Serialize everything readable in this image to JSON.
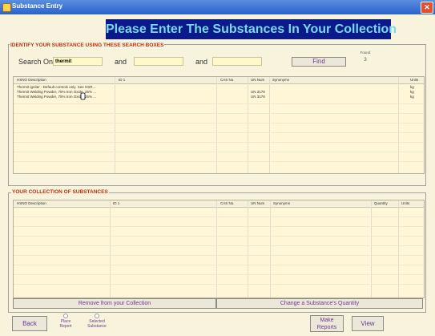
{
  "window": {
    "title": "Substance Entry",
    "close": "✕"
  },
  "banner": "Please Enter The Substances In Your Collection",
  "search": {
    "section_title": "IDENTIFY YOUR SUBSTANCE USING THESE SEARCH BOXES",
    "label": "Search On",
    "value1": "thermit",
    "and1": "and",
    "value2": "",
    "and2": "and",
    "value3": "",
    "find_button": "Find",
    "found_label": "Found",
    "found_count": "3"
  },
  "results": {
    "headers": [
      "HSNO Description",
      "ID 1",
      "CAS No.",
      "UN Num",
      "Synonyms",
      "Units"
    ],
    "rows": [
      {
        "desc": "Thermit igniter - Default controls only. See HSR...",
        "id": "",
        "cas": "",
        "un": "",
        "syn": "",
        "units": "kg"
      },
      {
        "desc": "Thermit Welding Powder, 75% Iron Oxide, 25% ...",
        "id": "",
        "cas": "",
        "un": "UN 3178",
        "syn": "",
        "units": "kg"
      },
      {
        "desc": "Thermit Welding Powder, 75% Iron Oxide, 25% ...",
        "id": "",
        "cas": "",
        "un": "UN 3178",
        "syn": "",
        "units": "kg"
      }
    ]
  },
  "collection": {
    "section_title": "YOUR COLLECTION OF SUBSTANCES",
    "headers": [
      "HSNO Description",
      "ID 1",
      "CAS No.",
      "UN Num",
      "Synonyms",
      "Quantity",
      "Units"
    ],
    "remove_button": "Remove from your Collection",
    "change_button": "Change a Substance's Quantity"
  },
  "footer": {
    "back": "Back",
    "place_report_1": "Place",
    "place_report_2": "Report",
    "selected_substance_1": "Selected",
    "selected_substance_2": "Substance",
    "make_reports_1": "Make",
    "make_reports_2": "Reports",
    "view": "View"
  }
}
